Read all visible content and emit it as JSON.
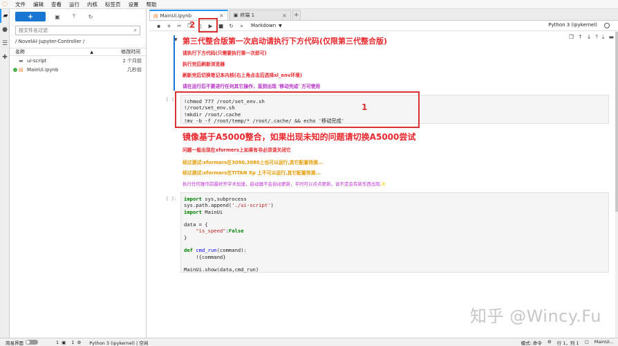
{
  "menu": {
    "items": [
      "文件",
      "编辑",
      "查看",
      "运行",
      "内核",
      "标签页",
      "设置",
      "帮助"
    ]
  },
  "filebrowser": {
    "new_label": "+",
    "search_placeholder": "按文件名过滤",
    "breadcrumb": "/ NovelAI-Jupyter-Controller /",
    "col_name": "名称",
    "col_modified": "修改时间",
    "files": [
      {
        "name": "ui-script",
        "modified": "2 个月前",
        "type": "folder"
      },
      {
        "name": "MainUi.ipynb",
        "modified": "几秒前",
        "type": "notebook"
      }
    ]
  },
  "tabs": [
    {
      "label": "MainUi.ipynb",
      "icon": "notebook-icon"
    },
    {
      "label": "终端 1",
      "icon": "terminal-icon"
    }
  ],
  "toolbar": {
    "cell_type": "Markdown",
    "kernel": "Python 3 (ipykernel)"
  },
  "notebook": {
    "h1": "第三代整合版第一次启动请执行下方代码(仅限第三代整合版)",
    "lines1": [
      "请执行下方代码(只需要执行第一次即可)",
      "执行完后刷新浏览器",
      "刷新完后切换笔记本内核(右上角点击后选择xl_env环境)",
      "请在运行后不要进行任何其它操作，直到出现 '移动完成' 方可使用"
    ],
    "prompt1": "[ ]:",
    "code1": [
      "!chmod 777 /root/set_env.sh",
      "!/root/set_env.sh",
      "!mkdir /root/.cache",
      "!mv -b -f /root/temp/* /root/.cache/ && echo '移动完成'"
    ],
    "h2": "镜像基于A5000整合，如果出现未知的问题请切换A5000尝试",
    "lines2": [
      "问题一般出现在xformers上如果有非必须请关闭它",
      "经过测试:xformers在3090,3080上也可以运行,其它配置待测...",
      "经过测试:xformers在TITAN Xp 上不可以运行,其它配置待测...",
      "执行任何操作前最好开学术加速，启动器不会自动更新，平时可以点点更新，说不定会有新东西出现✨"
    ],
    "prompt2": "[ ]:",
    "code2": {
      "l1": [
        "import",
        " sys,subprocess"
      ],
      "l2a": "sys.path.append(",
      "l2b": "'./ui-script'",
      "l2c": ")",
      "l3": [
        "import",
        " MainUi"
      ],
      "l5": "data = {",
      "l6a": "\"is_speed\"",
      "l6b": ":",
      "l6c": "False",
      "l7": "}",
      "l9a": "def",
      "l9b": "cmd_run",
      "l9c": "(command):",
      "l10": "    !{command}",
      "l12": "MainUi.show(data,cmd_run)"
    }
  },
  "annotations": {
    "box1": "1",
    "box2": "2"
  },
  "watermark": "知乎 @Wincy.Fu",
  "statusbar": {
    "simple": "简易界面",
    "count1": "1",
    "count2": "1",
    "kernel_status": "Python 3 (ipykernel) | 空闲",
    "mode": "模式: 命令",
    "position": "行 1，列 1",
    "filename": "MainUi..."
  }
}
